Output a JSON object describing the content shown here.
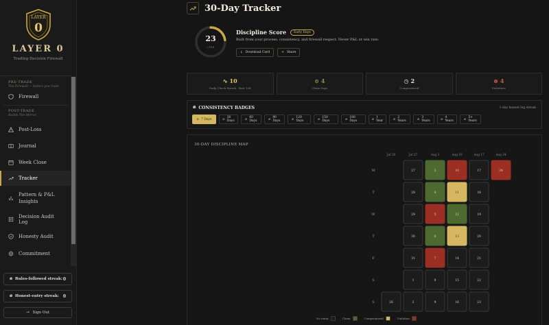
{
  "brand": {
    "name": "LAYER 0",
    "logo_text": "LAYER",
    "logo_digit": "0",
    "tagline": "Trading Decision Firewall"
  },
  "sidebar": {
    "sections": [
      {
        "title": "PRE-TRADE",
        "subtitle": "The Firewall — before you trade",
        "items": [
          {
            "label": "Firewall",
            "icon": "shield-icon"
          }
        ]
      },
      {
        "title": "POST-TRADE",
        "subtitle": "Builds The Mirror",
        "items": [
          {
            "label": "Post-Loss",
            "icon": "warning-icon"
          },
          {
            "label": "Journal",
            "icon": "book-icon"
          },
          {
            "label": "Week Close",
            "icon": "calendar-icon"
          },
          {
            "label": "Tracker",
            "icon": "trend-icon",
            "active": true
          },
          {
            "label": "Pattern & P&L Insights",
            "icon": "bar-chart-icon"
          },
          {
            "label": "Decision Audit Log",
            "icon": "log-icon"
          },
          {
            "label": "Honesty Audit",
            "icon": "shield-check-icon"
          },
          {
            "label": "Commitment",
            "icon": "seal-icon"
          }
        ]
      }
    ],
    "streaks": [
      {
        "label": "Rules-followed streak:",
        "value": "0"
      },
      {
        "label": "Honest-entry streak:",
        "value": "0"
      }
    ],
    "sign_out": "Sign Out"
  },
  "header": {
    "title": "30-Day Tracker"
  },
  "score": {
    "value": "23",
    "max_label": "/ 100",
    "fraction": 0.23,
    "title": "Discipline Score",
    "level": "Early Days",
    "description": "Built from your process, consistency, and firewall respect. Never P&L or win rate.",
    "download_label": "Download Card",
    "share_label": "Share"
  },
  "stats": [
    {
      "value": "10",
      "label": "Daily Check Streak · Best 10d",
      "color": "#e6c56b",
      "icon": "pulse-icon"
    },
    {
      "value": "4",
      "label": "Clean Days",
      "color": "#7c9a5a",
      "icon": "check-circle-icon"
    },
    {
      "value": "2",
      "label": "Compromised",
      "color": "#e8e3d8",
      "icon": "clock-icon"
    },
    {
      "value": "4",
      "label": "Violations",
      "color": "#d25a4a",
      "icon": "x-circle-icon"
    }
  ],
  "badges": {
    "title": "CONSISTENCY BADGES",
    "meta": "1-day honest log streak",
    "items": [
      "7 Days",
      "30 Days",
      "60 Days",
      "90 Days",
      "120 Days",
      "150 Days",
      "180 Days",
      "1 Year",
      "2 Years",
      "3 Years",
      "4 Years",
      "5+ Years"
    ],
    "active_index": 0
  },
  "map": {
    "title": "30-DAY DISCIPLINE MAP",
    "weeks": [
      "Jul 20",
      "Jul 27",
      "Aug 3",
      "Aug 10",
      "Aug 17",
      "Aug 24"
    ],
    "days": [
      "M",
      "T",
      "W",
      "T",
      "F",
      "S",
      "S"
    ],
    "grid": [
      [
        null,
        {
          "d": "27",
          "s": "none"
        },
        {
          "d": "3",
          "s": "clean"
        },
        {
          "d": "10",
          "s": "violation"
        },
        {
          "d": "17",
          "s": "none"
        },
        {
          "d": "24",
          "s": "violation"
        }
      ],
      [
        null,
        {
          "d": "28",
          "s": "none"
        },
        {
          "d": "4",
          "s": "clean"
        },
        {
          "d": "11",
          "s": "compromised"
        },
        {
          "d": "18",
          "s": "none"
        },
        null
      ],
      [
        null,
        {
          "d": "29",
          "s": "none"
        },
        {
          "d": "5",
          "s": "violation"
        },
        {
          "d": "12",
          "s": "clean"
        },
        {
          "d": "19",
          "s": "none"
        },
        null
      ],
      [
        null,
        {
          "d": "30",
          "s": "none"
        },
        {
          "d": "6",
          "s": "clean"
        },
        {
          "d": "13",
          "s": "compromised"
        },
        {
          "d": "20",
          "s": "none"
        },
        null
      ],
      [
        null,
        {
          "d": "31",
          "s": "none"
        },
        {
          "d": "7",
          "s": "violation"
        },
        {
          "d": "14",
          "s": "none"
        },
        {
          "d": "21",
          "s": "none"
        },
        null
      ],
      [
        null,
        {
          "d": "1",
          "s": "none"
        },
        {
          "d": "8",
          "s": "none"
        },
        {
          "d": "15",
          "s": "none"
        },
        {
          "d": "22",
          "s": "none"
        },
        null
      ],
      [
        {
          "d": "26",
          "s": "none"
        },
        {
          "d": "2",
          "s": "none"
        },
        {
          "d": "9",
          "s": "none"
        },
        {
          "d": "16",
          "s": "none"
        },
        {
          "d": "23",
          "s": "none"
        },
        null
      ]
    ],
    "legend": [
      {
        "label": "No entry",
        "color": "#1c1c1c"
      },
      {
        "label": "Clean",
        "color": "#4e6a30"
      },
      {
        "label": "Compromised",
        "color": "#d4b760"
      },
      {
        "label": "Violation",
        "color": "#9b2f24"
      }
    ],
    "colors": {
      "none": "#1c1c1c",
      "clean": "#4e6a30",
      "compromised": "#d4b760",
      "violation": "#9b2f24"
    }
  }
}
